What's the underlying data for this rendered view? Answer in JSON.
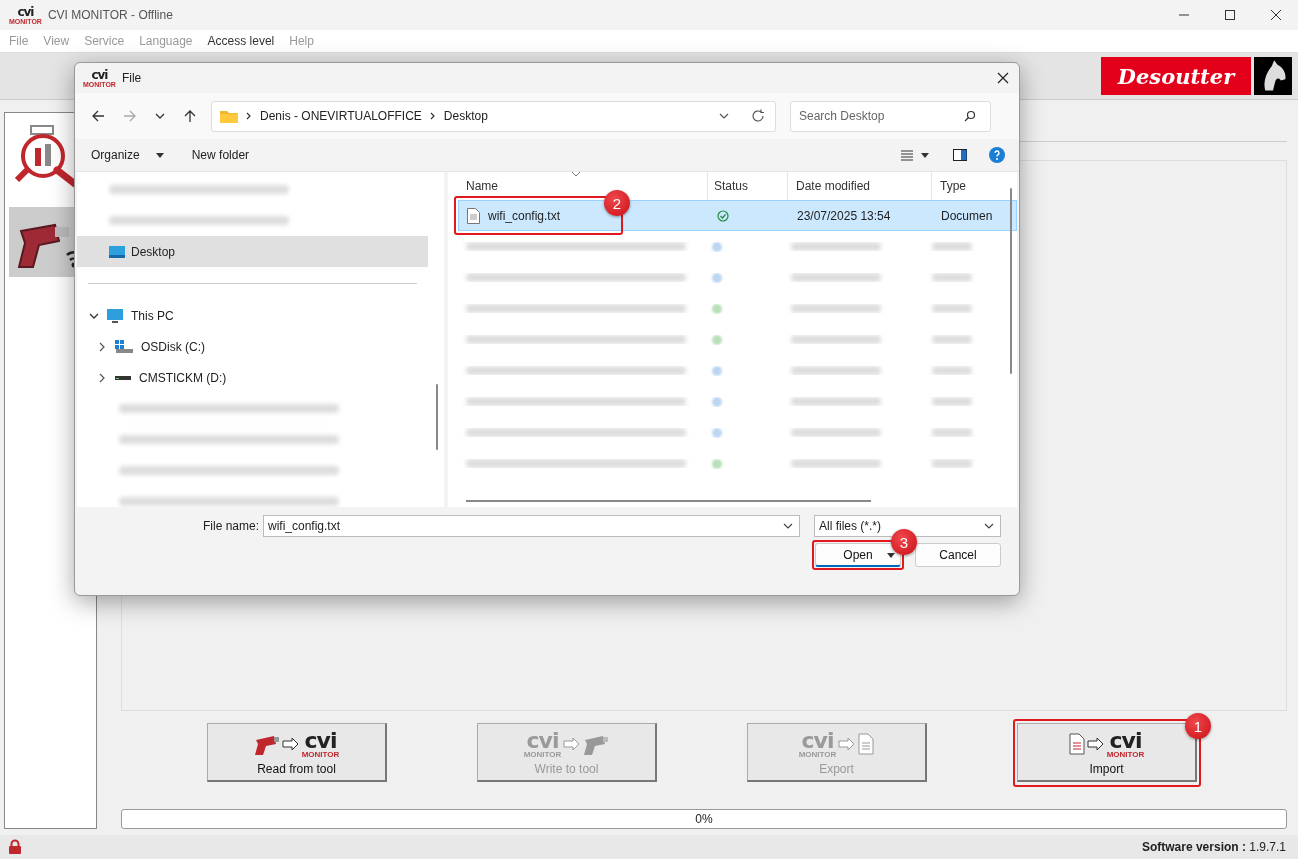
{
  "window": {
    "logo": "cvi",
    "logo_sub": "MONITOR",
    "title": "CVI MONITOR - Offline"
  },
  "menu": [
    {
      "label": "File",
      "disabled": true
    },
    {
      "label": "View",
      "disabled": true
    },
    {
      "label": "Service",
      "disabled": true
    },
    {
      "label": "Language",
      "disabled": true
    },
    {
      "label": "Access level",
      "disabled": false
    },
    {
      "label": "Help",
      "disabled": true
    }
  ],
  "brand": {
    "name": "Desoutter"
  },
  "side_tabs": [
    {
      "kind": "gauge",
      "selected": false
    },
    {
      "kind": "wireless-tool",
      "selected": true
    }
  ],
  "actions": [
    {
      "kind": "read",
      "label": "Read from tool",
      "logo": "cvi",
      "logo_sub": "MONITOR",
      "disabled": false
    },
    {
      "kind": "write",
      "label": "Write to tool",
      "logo": "cvi",
      "logo_sub": "MONITOR",
      "disabled": true
    },
    {
      "kind": "export",
      "label": "Export",
      "logo": "cvi",
      "logo_sub": "MONITOR",
      "disabled": true
    },
    {
      "kind": "import",
      "label": "Import",
      "logo": "cvi",
      "logo_sub": "MONITOR",
      "disabled": false,
      "callout": "1"
    }
  ],
  "progress": {
    "level": 0,
    "reading": "0%"
  },
  "status_bar": {
    "locked": true,
    "version": "**Software version :** 1.9.7.1"
  },
  "dialog": {
    "logo": "cvi",
    "logo_sub": "MONITOR",
    "title": "File",
    "path": [
      "Denis - ONEVIRTUALOFFICE",
      "Desktop"
    ],
    "search": {
      "placeholder": "Search Desktop"
    },
    "commands": {
      "organize": "Organize",
      "new_folder": "New folder"
    },
    "nav_quick": [
      {
        "kind": "blurred"
      },
      {
        "kind": "blurred"
      },
      {
        "kind": "folder",
        "label": "Desktop",
        "selected": true
      }
    ],
    "nav_tree": [
      {
        "kind": "pc",
        "label": "This PC",
        "expanded": true,
        "children": [
          {
            "kind": "disk",
            "label": "OSDisk (C:)",
            "expanded": false
          },
          {
            "kind": "usb",
            "label": "CMSTICKM (D:)",
            "expanded": false
          },
          {
            "kind": "blurred"
          },
          {
            "kind": "blurred"
          },
          {
            "kind": "blurred"
          },
          {
            "kind": "blurred"
          }
        ]
      }
    ],
    "columns": [
      {
        "label": "Name",
        "sorted": true
      },
      {
        "label": "Status"
      },
      {
        "label": "Date modified"
      },
      {
        "label": "Type"
      }
    ],
    "files": [
      {
        "kind": "file",
        "name": "wifi_config.txt",
        "synced": true,
        "date": "23/07/2025 13:54",
        "type": "Documen",
        "selected": true,
        "callout": "2"
      },
      {
        "kind": "blurred",
        "color": "#bcd6f2"
      },
      {
        "kind": "blurred",
        "color": "#bcd6f2"
      },
      {
        "kind": "blurred",
        "color": "#b9e0b9"
      },
      {
        "kind": "blurred",
        "color": "#b9e0b9"
      },
      {
        "kind": "blurred",
        "color": "#bcd6f2"
      },
      {
        "kind": "blurred",
        "color": "#bcd6f2"
      },
      {
        "kind": "blurred",
        "color": "#bcd6f2"
      },
      {
        "kind": "blurred",
        "color": "#b9e0b9"
      }
    ],
    "file_name_label": "File name:",
    "file_name": "wifi_config.txt",
    "filter": "All files (*.*)",
    "open": {
      "label": "Open",
      "callout": "3"
    },
    "cancel": "Cancel"
  }
}
